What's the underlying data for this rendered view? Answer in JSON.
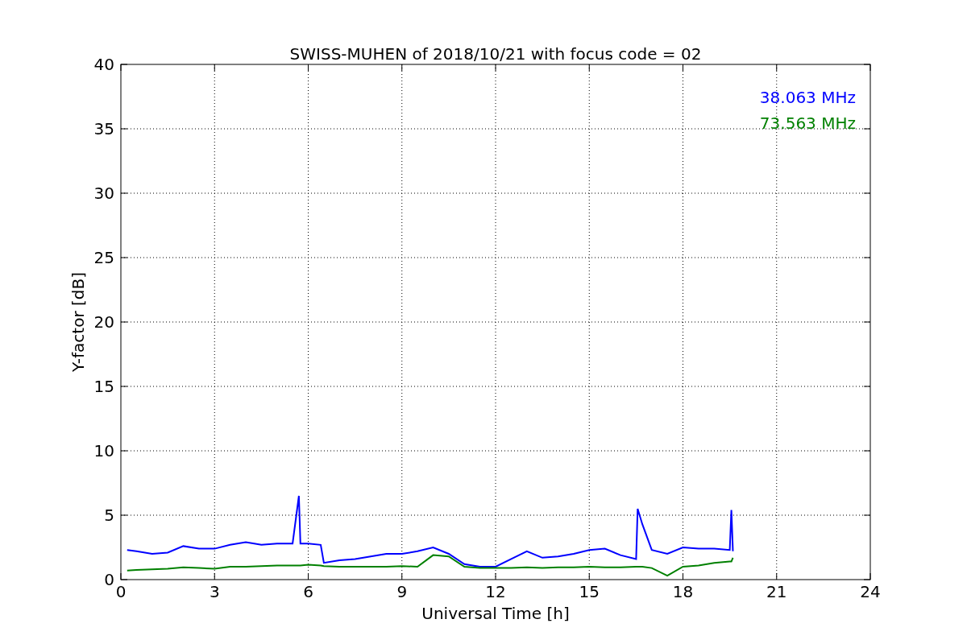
{
  "chart_data": {
    "type": "line",
    "title": "SWISS-MUHEN of 2018/10/21 with focus code = 02",
    "xlabel": "Universal Time [h]",
    "ylabel": "Y-factor [dB]",
    "x": [
      0.2,
      0.5,
      1,
      1.5,
      2,
      2.5,
      3,
      3.5,
      4,
      4.5,
      5,
      5.5,
      5.7,
      5.75,
      6,
      6.4,
      6.5,
      7,
      7.5,
      8,
      8.5,
      9,
      9.5,
      10,
      10.5,
      11,
      11.5,
      12,
      12.5,
      13,
      13.5,
      14,
      14.5,
      15,
      15.5,
      16,
      16.5,
      16.55,
      16.7,
      17,
      17.5,
      18,
      18.5,
      19,
      19.5,
      19.55,
      19.6
    ],
    "series": [
      {
        "name": "38.063 MHz",
        "color": "#0000ff",
        "values": [
          2.3,
          2.2,
          2.0,
          2.1,
          2.6,
          2.4,
          2.4,
          2.7,
          2.9,
          2.7,
          2.8,
          2.8,
          6.5,
          2.8,
          2.8,
          2.7,
          1.3,
          1.5,
          1.6,
          1.8,
          2.0,
          2.0,
          2.2,
          2.5,
          2.0,
          1.2,
          1.0,
          1.0,
          1.6,
          2.2,
          1.7,
          1.8,
          2.0,
          2.3,
          2.4,
          1.9,
          1.6,
          5.5,
          4.3,
          2.3,
          2.0,
          2.5,
          2.4,
          2.4,
          2.3,
          5.4,
          2.2
        ]
      },
      {
        "name": "73.563 MHz",
        "color": "#008000",
        "values": [
          0.7,
          0.75,
          0.8,
          0.85,
          0.95,
          0.9,
          0.85,
          1.0,
          1.0,
          1.05,
          1.1,
          1.1,
          1.1,
          1.1,
          1.15,
          1.1,
          1.05,
          1.0,
          1.0,
          1.0,
          1.0,
          1.05,
          1.0,
          1.9,
          1.8,
          1.0,
          0.9,
          0.9,
          0.9,
          0.95,
          0.9,
          0.95,
          0.95,
          1.0,
          0.95,
          0.95,
          1.0,
          1.0,
          1.0,
          0.9,
          0.3,
          1.0,
          1.1,
          1.3,
          1.4,
          1.4,
          1.7
        ]
      }
    ],
    "grid": true,
    "xlim": [
      0,
      24
    ],
    "ylim": [
      0,
      40
    ],
    "xticks": [
      0,
      3,
      6,
      9,
      12,
      15,
      18,
      21,
      24
    ],
    "yticks": [
      0,
      5,
      10,
      15,
      20,
      25,
      30,
      35,
      40
    ]
  }
}
